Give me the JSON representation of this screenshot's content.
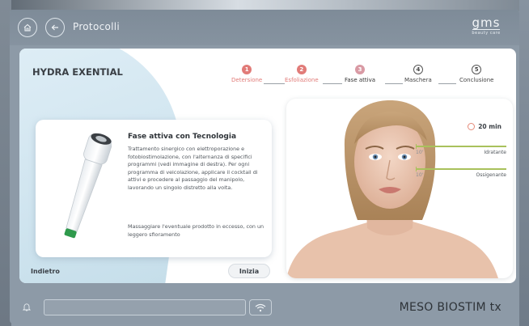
{
  "header": {
    "title": "Protocolli",
    "logo_text": "gms",
    "logo_subtext": "beauty care"
  },
  "product": {
    "name": "HYDRA EXENTIAL"
  },
  "steps": [
    {
      "number": "1",
      "label": "Detersione",
      "state": "done"
    },
    {
      "number": "2",
      "label": "Esfoliazione",
      "state": "done"
    },
    {
      "number": "3",
      "label": "Fase attiva",
      "state": "active"
    },
    {
      "number": "4",
      "label": "Maschera",
      "state": "todo"
    },
    {
      "number": "5",
      "label": "Conclusione",
      "state": "todo"
    }
  ],
  "info": {
    "heading": "Fase attiva con Tecnologia",
    "paragraph1": "Trattamento sinergico con elettroporazione e fotobiostimolazione, con l'alternanza di specifici programmi (vedi immagine di destra). Per ogni programma di veicolazione, applicare il cocktail di attivi e procedere al passaggio del manipolo, lavorando un singolo distretto alla volta.",
    "paragraph2": "Massaggiare l'eventuale prodotto in eccesso, con un leggero sfioramento"
  },
  "buttons": {
    "back": "Indietro",
    "start": "Inizia"
  },
  "timer": {
    "value": "20 min"
  },
  "programs": [
    {
      "minutes": "10'",
      "name": "Idratante",
      "fill": 1.0
    },
    {
      "minutes": "10'",
      "name": "Ossigenante",
      "fill": 1.0
    }
  ],
  "footer": {
    "brand": "MESO BIOSTIM tx"
  },
  "colors": {
    "accent_done": "#e17b78",
    "accent_active": "#d99aa4",
    "program_bar": "#a9c15c"
  }
}
